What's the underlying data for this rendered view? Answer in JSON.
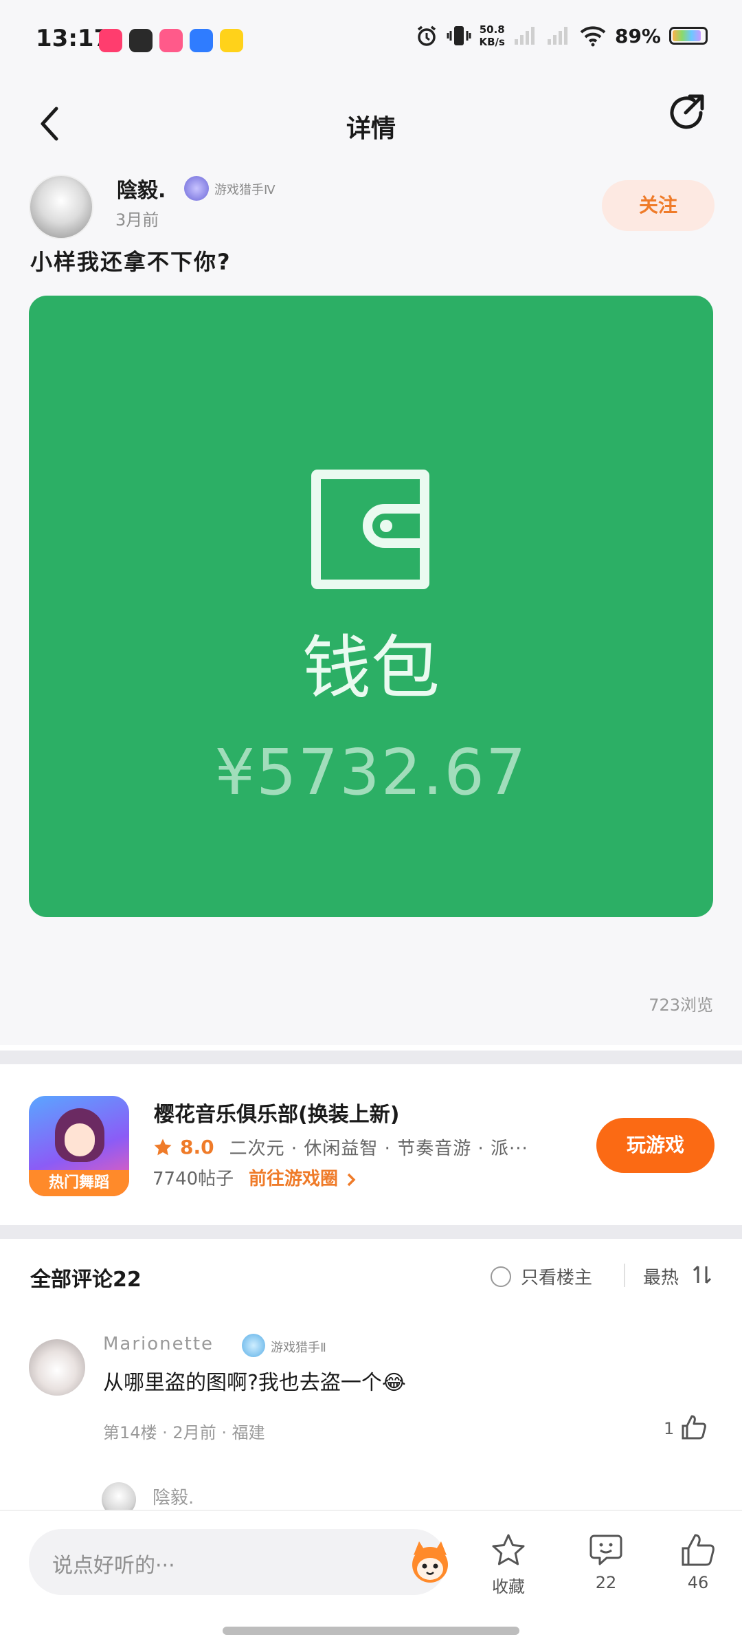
{
  "status_bar": {
    "time": "13:17",
    "network_speed_value": "50.8",
    "network_speed_unit": "KB/s",
    "battery_percent": "89%",
    "battery_level": 0.89,
    "app_icon_colors": [
      "#ff3d6e",
      "#2a2a2a",
      "#ff5a8a",
      "#2f7cff",
      "#ffd21a"
    ]
  },
  "header": {
    "title": "详情",
    "back_icon": "chevron-left-icon",
    "share_icon": "share-icon"
  },
  "post": {
    "author": {
      "name": "陰毅.",
      "badge": "游戏猎手Ⅳ",
      "time": "3月前"
    },
    "follow_label": "关注",
    "title": "小样我还拿不下你?",
    "image": {
      "background_color": "#2caf65",
      "label": "钱包",
      "amount": "¥5732.67"
    },
    "views": "723浏览"
  },
  "game": {
    "name": "樱花音乐俱乐部(换装上新)",
    "rating": "8.0",
    "tags": "二次元 · 休闲益智 · 节奏音游 · 派···",
    "posts": "7740帖子",
    "circle_link": "前往游戏圈",
    "icon_tag": "热门舞蹈",
    "play_label": "玩游戏"
  },
  "comments": {
    "title": "全部评论22",
    "only_owner": "只看楼主",
    "sort_label": "最热",
    "items": [
      {
        "user": "Marionette",
        "badge": "游戏猎手Ⅱ",
        "text": "从哪里盗的图啊?我也去盗一个😂",
        "meta": "第14楼 · 2月前 · 福建",
        "likes": "1"
      }
    ],
    "reply_preview_name": "陰毅."
  },
  "bottom_bar": {
    "input_placeholder": "说点好听的···",
    "favorite_label": "收藏",
    "comment_count": "22",
    "like_count": "46"
  },
  "colors": {
    "accent_orange": "#ef7b29",
    "play_button": "#fb6a14",
    "follow_bg": "#fde9e2",
    "wallet_green": "#2caf65"
  }
}
